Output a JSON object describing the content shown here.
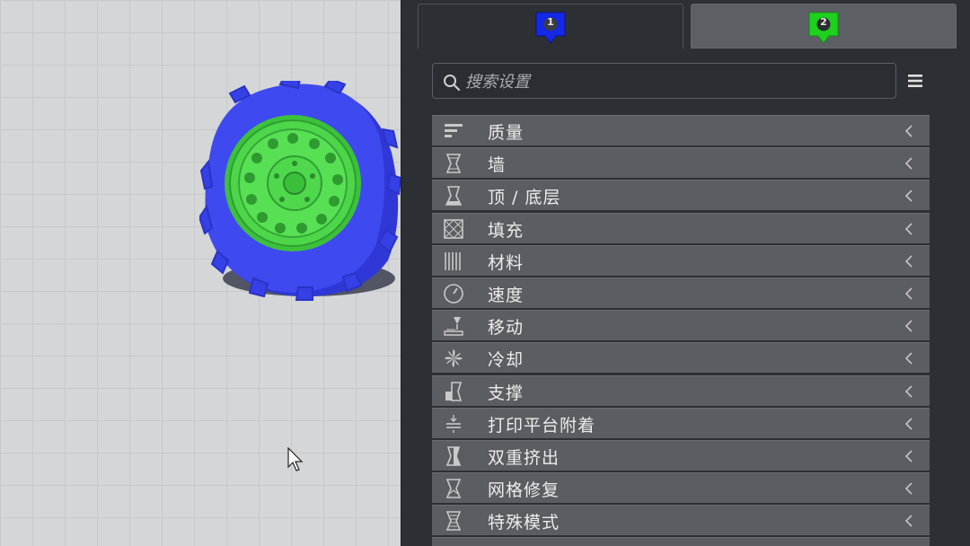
{
  "extruders": {
    "tab1": {
      "label": "1",
      "color": "#1528e6"
    },
    "tab2": {
      "label": "2",
      "color": "#1fd11f"
    }
  },
  "search": {
    "placeholder": "搜索设置"
  },
  "categories": [
    {
      "label": "质量",
      "icon": "quality-icon"
    },
    {
      "label": "墙",
      "icon": "walls-icon"
    },
    {
      "label": "顶 / 底层",
      "icon": "top-bottom-icon"
    },
    {
      "label": "填充",
      "icon": "infill-icon"
    },
    {
      "label": "材料",
      "icon": "material-icon"
    },
    {
      "label": "速度",
      "icon": "speed-icon"
    },
    {
      "label": "移动",
      "icon": "travel-icon"
    },
    {
      "label": "冷却",
      "icon": "cooling-icon"
    },
    {
      "label": "支撑",
      "icon": "support-icon"
    },
    {
      "label": "打印平台附着",
      "icon": "adhesion-icon"
    },
    {
      "label": "双重挤出",
      "icon": "dual-extrusion-icon"
    },
    {
      "label": "网格修复",
      "icon": "mesh-fix-icon"
    },
    {
      "label": "特殊模式",
      "icon": "special-modes-icon"
    }
  ],
  "colors": {
    "tire": "#3f49f0",
    "rim": "#4dd64a",
    "panel_bg": "#2c2f34",
    "row_bg": "#5a5d61"
  }
}
